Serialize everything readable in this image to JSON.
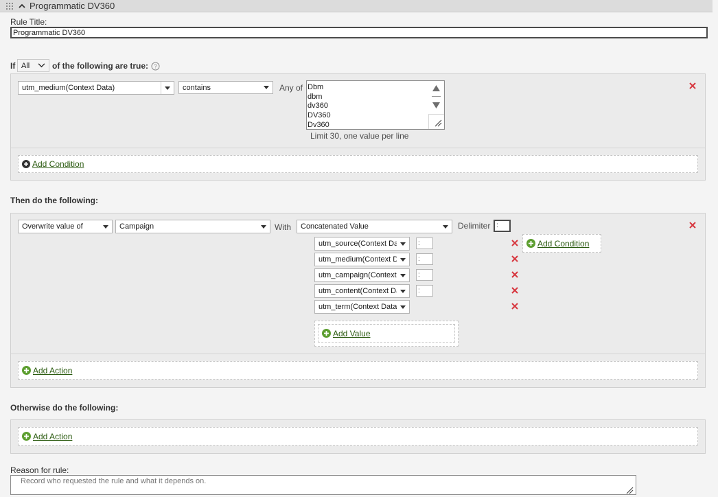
{
  "header": {
    "title": "Programmatic DV360"
  },
  "rule_title": {
    "label": "Rule Title:",
    "value": "Programmatic DV360"
  },
  "if_clause": {
    "prefix": "If",
    "match_mode": "All",
    "suffix": "of the following are true:",
    "condition": {
      "field": "utm_medium(Context Data)",
      "operator": "contains",
      "any_of_label": "Any of",
      "values": [
        "Dbm",
        "dbm",
        "dv360",
        "DV360",
        "Dv360"
      ],
      "hint": "Limit 30, one value per line"
    },
    "add_condition_label": "Add Condition"
  },
  "then_clause": {
    "heading": "Then do the following:",
    "action": "Overwrite value of",
    "target": "Campaign",
    "with_label": "With",
    "value_type": "Concatenated Value",
    "delimiter_label": "Delimiter",
    "delimiter_value": ":",
    "values": [
      {
        "label": "utm_source(Context Data)",
        "delim": ":"
      },
      {
        "label": "utm_medium(Context Data)",
        "delim": ":"
      },
      {
        "label": "utm_campaign(Context Data)",
        "delim": ":"
      },
      {
        "label": "utm_content(Context Data)",
        "delim": ":"
      },
      {
        "label": "utm_term(Context Data)",
        "delim": ""
      }
    ],
    "add_condition_label": "Add Condition",
    "add_value_label": "Add Value",
    "add_action_label": "Add Action"
  },
  "otherwise_clause": {
    "heading": "Otherwise do the following:",
    "add_action_label": "Add Action"
  },
  "reason": {
    "label": "Reason for rule:",
    "placeholder": "Record who requested the rule and what it depends on."
  },
  "colors": {
    "link": "#2a5a0f",
    "plus_green": "#5c9e2f",
    "remove_red": "#d7373f"
  }
}
